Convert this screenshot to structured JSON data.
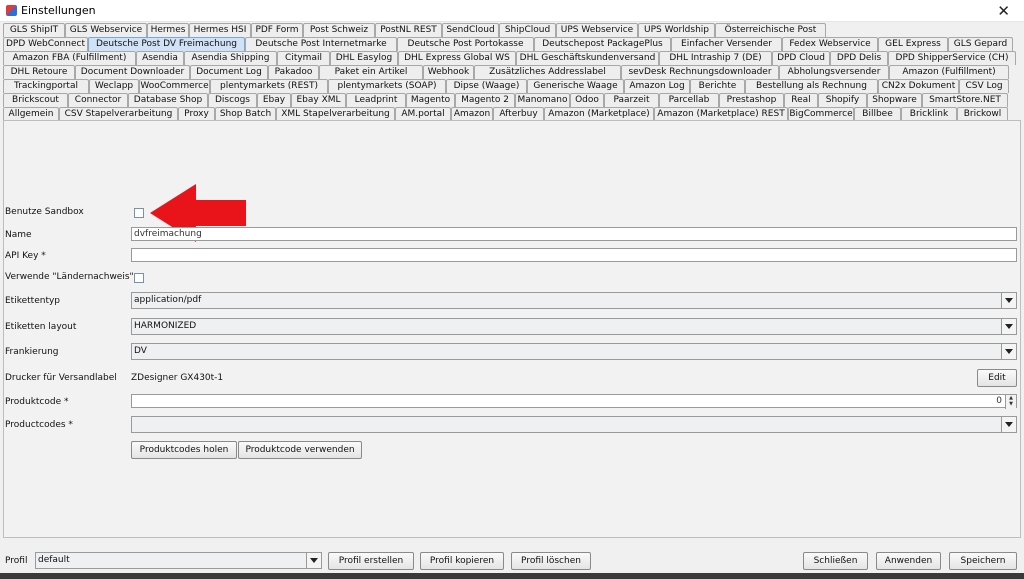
{
  "window": {
    "title": "Einstellungen",
    "close": "✕"
  },
  "tabs": {
    "row1": [
      "GLS ShipIT",
      "GLS Webservice",
      "Hermes",
      "Hermes HSI",
      "PDF Form",
      "Post Schweiz",
      "PostNL REST",
      "SendCloud",
      "ShipCloud",
      "UPS Webservice",
      "UPS Worldship",
      "Österreichische Post"
    ],
    "row2": [
      "DPD WebConnect",
      "Deutsche Post DV Freimachung",
      "Deutsche Post Internetmarke",
      "Deutsche Post Portokasse",
      "Deutschepost PackagePlus",
      "Einfacher Versender",
      "Fedex Webservice",
      "GEL Express",
      "GLS Gepard"
    ],
    "row3": [
      "Amazon FBA (Fulfillment)",
      "Asendia",
      "Asendia Shipping",
      "Citymail",
      "DHL Easylog",
      "DHL Express Global WS",
      "DHL Geschäftskundenversand",
      "DHL Intraship 7 (DE)",
      "DPD Cloud",
      "DPD Delis",
      "DPD ShipperService (CH)"
    ],
    "row4": [
      "DHL Retoure",
      "Document Downloader",
      "Document Log",
      "Pakadoo",
      "Paket ein Artikel",
      "Webhook",
      "Zusätzliches Addresslabel",
      "sevDesk Rechnungsdownloader",
      "Abholungsversender",
      "Amazon (Fulfillment)"
    ],
    "row5": [
      "Trackingportal",
      "Weclapp",
      "WooCommerce",
      "plentymarkets (REST)",
      "plentymarkets (SOAP)",
      "Dipse (Waage)",
      "Generische Waage",
      "Amazon Log",
      "Berichte",
      "Bestellung als Rechnung",
      "CN2x Dokument",
      "CSV Log"
    ],
    "row6": [
      "Brickscout",
      "Connector",
      "Database Shop",
      "Discogs",
      "Ebay",
      "Ebay XML",
      "Leadprint",
      "Magento",
      "Magento 2",
      "Manomano",
      "Odoo",
      "Paarzeit",
      "Parcellab",
      "Prestashop",
      "Real",
      "Shopify",
      "Shopware",
      "SmartStore.NET"
    ],
    "row7": [
      "Allgemein",
      "CSV Stapelverarbeitung",
      "Proxy",
      "Shop Batch",
      "XML Stapelverarbeitung",
      "AM.portal",
      "Amazon",
      "Afterbuy",
      "Amazon (Marketplace)",
      "Amazon (Marketplace) REST",
      "BigCommerce",
      "Billbee",
      "Bricklink",
      "Brickowl"
    ],
    "selected": "Deutsche Post DV Freimachung"
  },
  "form": {
    "sandbox_label": "Benutze Sandbox",
    "name_label": "Name",
    "name_value": "dvfreimachung",
    "apikey_label": "API Key *",
    "apikey_value": "",
    "laendernachweis_label": "Verwende \"Ländernachweis\"",
    "etikettentyp_label": "Etikettentyp",
    "etikettentyp_value": "application/pdf",
    "layout_label": "Etiketten layout",
    "layout_value": "HARMONIZED",
    "frankierung_label": "Frankierung",
    "frankierung_value": "DV",
    "drucker_label": "Drucker für Versandlabel",
    "drucker_value": "ZDesigner GX430t-1",
    "edit_button": "Edit",
    "produktcode_label": "Produktcode *",
    "produktcode_value": "0",
    "productcodes_label": "Productcodes *",
    "productcodes_value": "",
    "holen_button": "Produktcodes holen",
    "verwenden_button": "Produktcode verwenden"
  },
  "bottom": {
    "profil_label": "Profil",
    "profil_value": "default",
    "erstellen_button": "Profil erstellen",
    "kopieren_button": "Profil kopieren",
    "loeschen_button": "Profil löschen",
    "schliessen_button": "Schließen",
    "anwenden_button": "Anwenden",
    "speichern_button": "Speichern"
  },
  "colors": {
    "arrow": "#e8141a",
    "selected_tab": "#cfe2f6"
  },
  "icons": {
    "app": "app-icon",
    "close": "close-icon",
    "dropdown": "chevron-down-icon",
    "annotation": "red-arrow-icon"
  }
}
